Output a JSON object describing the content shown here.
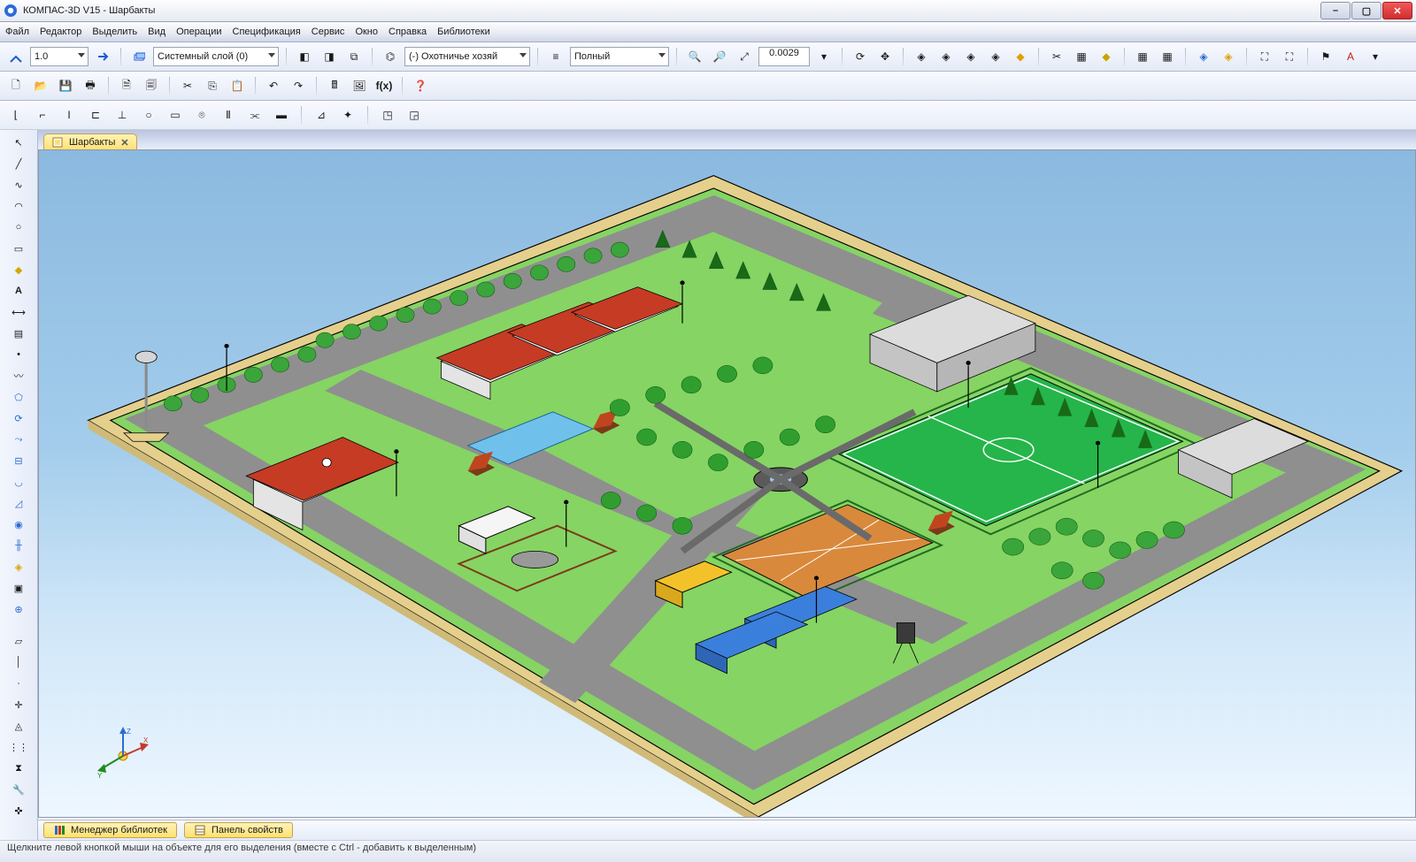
{
  "title": "КОМПАС-3D V15 - Шарбакты",
  "menu": [
    "Файл",
    "Редактор",
    "Выделить",
    "Вид",
    "Операции",
    "Спецификация",
    "Сервис",
    "Окно",
    "Справка",
    "Библиотеки"
  ],
  "toolbar1": {
    "scale": "1.0",
    "layer": "Системный слой (0)",
    "hunting": "(-) Охотничье хозяй",
    "viewmode": "Полный",
    "zoom": "0.0029"
  },
  "tab": {
    "label": "Шарбакты"
  },
  "panels": {
    "libs": "Менеджер библиотек",
    "props": "Панель свойств"
  },
  "status": "Щелкните левой кнопкой мыши на объекте для его выделения (вместе с Ctrl - добавить к выделенным)"
}
